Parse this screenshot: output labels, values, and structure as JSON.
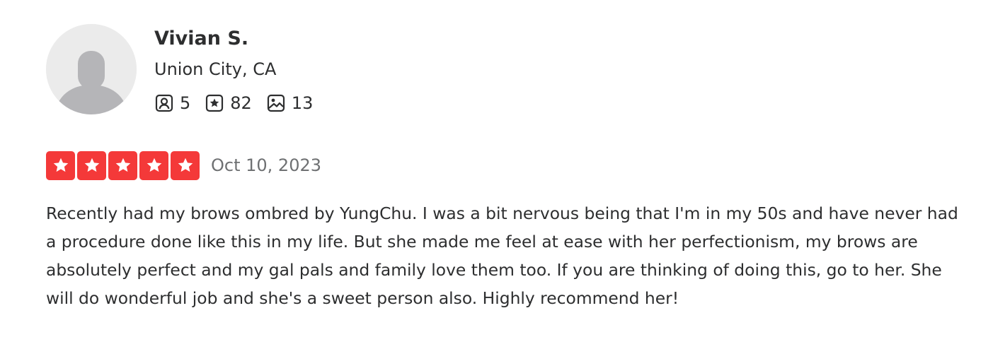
{
  "reviewer": {
    "name": "Vivian S.",
    "location": "Union City, CA",
    "avatar_icon": "default-user-avatar",
    "stats": [
      {
        "icon": "friends-icon",
        "value": "5"
      },
      {
        "icon": "reviews-icon",
        "value": "82"
      },
      {
        "icon": "photos-icon",
        "value": "13"
      }
    ]
  },
  "review": {
    "rating": 5,
    "rating_max": 5,
    "star_color": "#f43939",
    "date": "Oct 10, 2023",
    "text": "Recently had my brows ombred by YungChu. I was a bit nervous being that I'm in my 50s and have never had a procedure done like this in my life. But she made me feel at ease with her perfectionism, my brows are absolutely perfect and my gal pals and family love them too. If you are thinking of doing this, go to her. She will do wonderful job and she's a sweet person also. Highly recommend her!"
  }
}
